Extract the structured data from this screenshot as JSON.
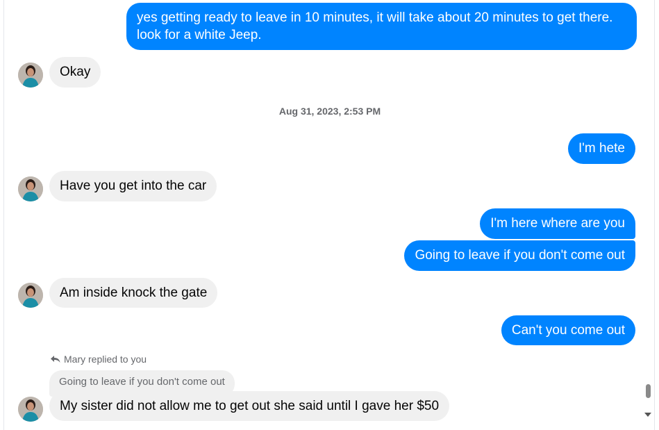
{
  "thread": {
    "timestamp": "Aug 31, 2023, 2:53 PM",
    "messages": [
      {
        "from": "me",
        "text": "yes getting ready to leave in 10 minutes, it will take about 20 minutes to get there. look for a white Jeep."
      },
      {
        "from": "them",
        "text": "Okay"
      },
      {
        "from": "me",
        "text": "I'm hete"
      },
      {
        "from": "them",
        "text": "Have you get into the car"
      },
      {
        "from": "me",
        "text": "I'm here where are you"
      },
      {
        "from": "me",
        "text": "Going to leave if you don't come out"
      },
      {
        "from": "them",
        "text": "Am inside knock the gate"
      },
      {
        "from": "me",
        "text": "Can't you come out"
      },
      {
        "from": "them",
        "text": "My sister did not allow me to get out she said until I gave her $50"
      }
    ],
    "reply": {
      "label": "Mary replied to you",
      "quoted": "Going to leave if you don't come out",
      "icon": "reply-arrow-icon"
    }
  },
  "colors": {
    "outgoing_bubble": "#0084ff",
    "incoming_bubble": "#f0f0f0",
    "meta_text": "#65676b"
  }
}
